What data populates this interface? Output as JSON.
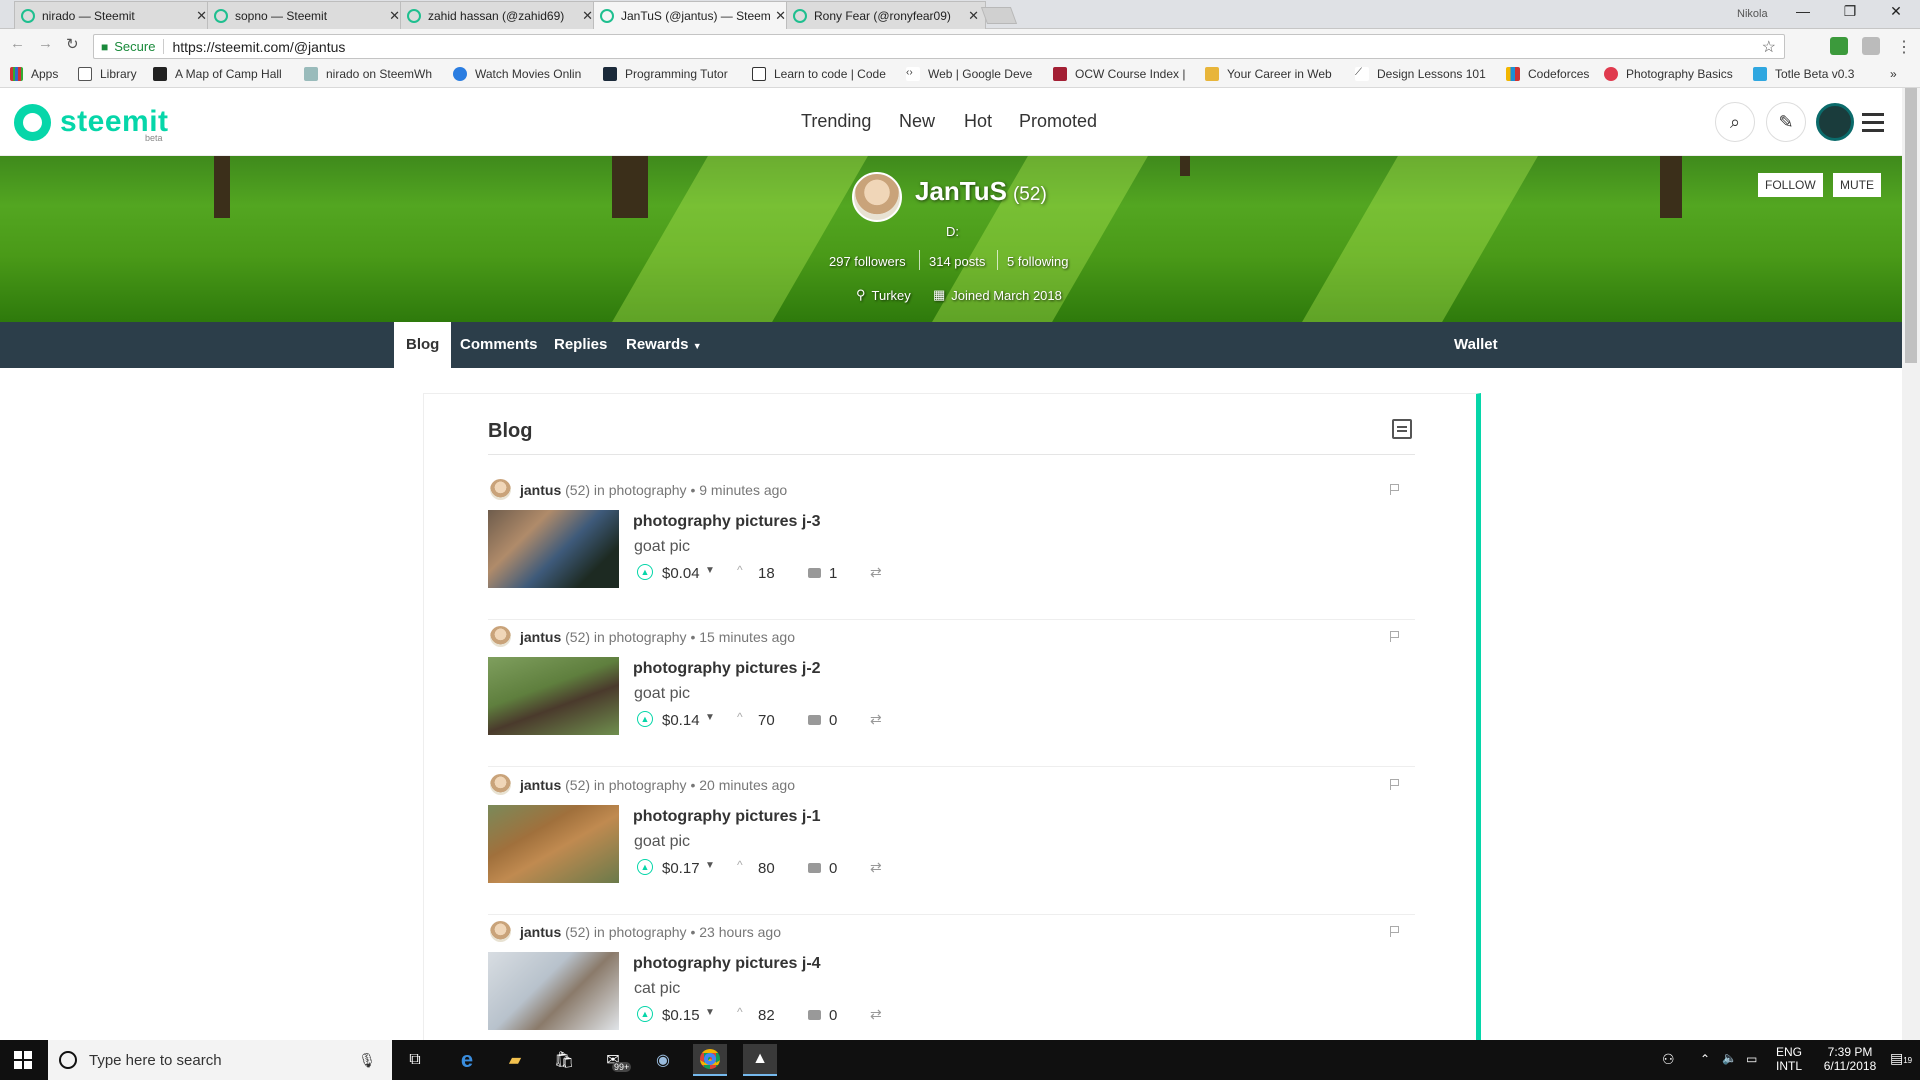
{
  "browser": {
    "tabs": [
      {
        "title": "nirado — Steemit"
      },
      {
        "title": "sopno — Steemit"
      },
      {
        "title": "zahid hassan (@zahid69)"
      },
      {
        "title": "JanTuS (@jantus) — Steemit"
      },
      {
        "title": "Rony Fear (@ronyfear09)"
      }
    ],
    "active_tab": 3,
    "profile_name": "Nikola",
    "secure_label": "Secure",
    "url": "https://steemit.com/@jantus",
    "bookmarks": [
      {
        "label": "Apps"
      },
      {
        "label": "Library"
      },
      {
        "label": "A Map of Camp Hall"
      },
      {
        "label": "nirado on SteemWh"
      },
      {
        "label": "Watch Movies Onlin"
      },
      {
        "label": "Programming Tutor"
      },
      {
        "label": "Learn to code | Code"
      },
      {
        "label": "Web | Google Deve"
      },
      {
        "label": "OCW Course Index |"
      },
      {
        "label": "Your Career in Web"
      },
      {
        "label": "Design Lessons 101"
      },
      {
        "label": "Codeforces"
      },
      {
        "label": "Photography Basics"
      },
      {
        "label": "Totle Beta v0.3"
      }
    ],
    "bookmarks_overflow": "»"
  },
  "site": {
    "logo_text": "steemit",
    "logo_badge": "beta",
    "nav": [
      {
        "label": "Trending"
      },
      {
        "label": "New"
      },
      {
        "label": "Hot"
      },
      {
        "label": "Promoted"
      }
    ]
  },
  "profile": {
    "name": "JanTuS",
    "reputation": "(52)",
    "about": "D:",
    "followers": "297 followers",
    "posts": "314 posts",
    "following": "5 following",
    "location": "Turkey",
    "joined": "Joined March 2018",
    "follow_label": "FOLLOW",
    "mute_label": "MUTE"
  },
  "profile_nav": {
    "tabs": [
      {
        "label": "Blog"
      },
      {
        "label": "Comments"
      },
      {
        "label": "Replies"
      },
      {
        "label": "Rewards"
      }
    ],
    "wallet_label": "Wallet"
  },
  "blog": {
    "heading": "Blog",
    "posts": [
      {
        "author": "jantus",
        "rep": "(52)",
        "in": "in",
        "category": "photography",
        "time": "• 9 minutes ago",
        "title": "photography pictures j-3",
        "body": "goat pic",
        "payout": "$0.04",
        "votes": "18",
        "comments": "1"
      },
      {
        "author": "jantus",
        "rep": "(52)",
        "in": "in",
        "category": "photography",
        "time": "• 15 minutes ago",
        "title": "photography pictures j-2",
        "body": "goat pic",
        "payout": "$0.14",
        "votes": "70",
        "comments": "0"
      },
      {
        "author": "jantus",
        "rep": "(52)",
        "in": "in",
        "category": "photography",
        "time": "• 20 minutes ago",
        "title": "photography pictures j-1",
        "body": "goat pic",
        "payout": "$0.17",
        "votes": "80",
        "comments": "0"
      },
      {
        "author": "jantus",
        "rep": "(52)",
        "in": "in",
        "category": "photography",
        "time": "• 23 hours ago",
        "title": "photography pictures j-4",
        "body": "cat pic",
        "payout": "$0.15",
        "votes": "82",
        "comments": "0"
      }
    ]
  },
  "taskbar": {
    "search_placeholder": "Type here to search",
    "store_badge": "99+",
    "lang": "ENG",
    "lang_sub": "INTL",
    "time": "7:39 PM",
    "date": "6/11/2018",
    "notif_count": "19"
  }
}
